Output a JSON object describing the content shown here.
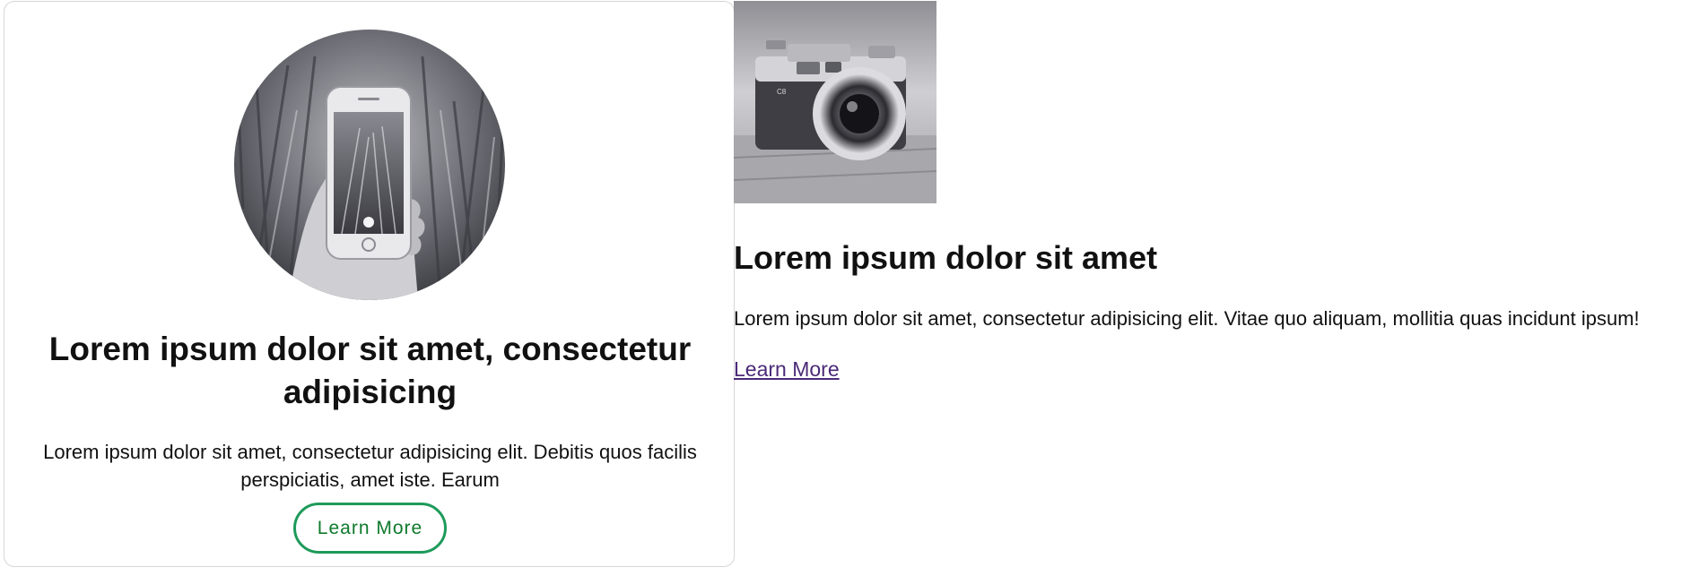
{
  "card": {
    "image_description_icon": "phone-photo",
    "title": "Lorem ipsum dolor sit amet, consectetur adipisicing",
    "text": "Lorem ipsum dolor sit amet, consectetur adipisicing elit. Debitis quos facilis perspiciatis, amet iste. Earum",
    "button_label": "Learn More",
    "button_color": "#1e9a5a",
    "button_text_color": "#0f7a2c"
  },
  "media": {
    "image_icon": "camera-photo",
    "title": "Lorem ipsum dolor sit amet",
    "text": "Lorem ipsum dolor sit amet, consectetur adipisicing elit. Vitae quo aliquam, mollitia quas incidunt ipsum!",
    "link_label": "Learn More",
    "link_color": "#4b2a78"
  }
}
